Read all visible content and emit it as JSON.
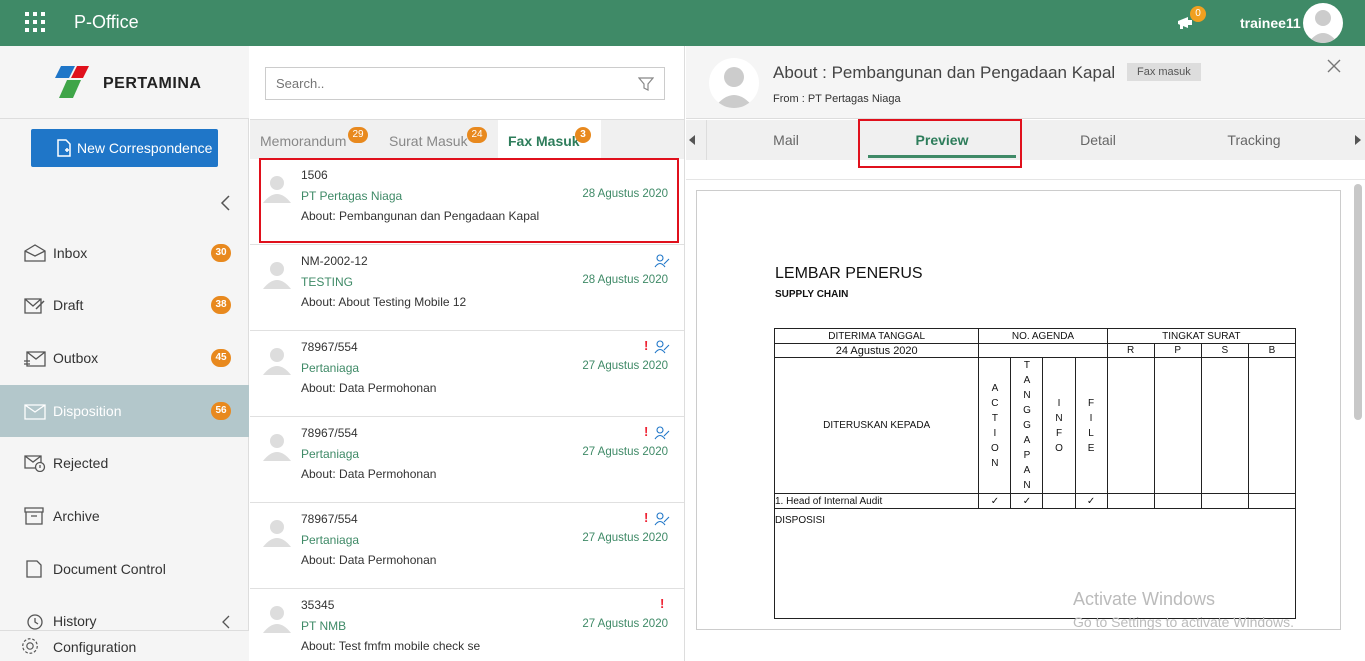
{
  "topbar": {
    "app_title": "P-Office",
    "notif_count": "0",
    "user_name": "trainee11",
    "bg_color": "#3f8a67"
  },
  "sidebar": {
    "logo_text": "PERTAMINA",
    "new_button": "New Correspondence",
    "items": [
      {
        "label": "Inbox",
        "badge": "30",
        "icon": "inbox-icon"
      },
      {
        "label": "Draft",
        "badge": "38",
        "icon": "draft-icon"
      },
      {
        "label": "Outbox",
        "badge": "45",
        "icon": "outbox-icon"
      },
      {
        "label": "Disposition",
        "badge": "56",
        "icon": "disposition-icon"
      },
      {
        "label": "Rejected",
        "badge": "",
        "icon": "rejected-icon"
      },
      {
        "label": "Archive",
        "badge": "",
        "icon": "archive-icon"
      },
      {
        "label": "Document Control",
        "badge": "",
        "icon": "document-icon"
      },
      {
        "label": "History",
        "badge": "",
        "icon": "history-icon"
      }
    ],
    "config_label": "Configuration"
  },
  "list": {
    "search_placeholder": "Search..",
    "tabs": [
      {
        "label": "Memorandum",
        "badge": "29"
      },
      {
        "label": "Surat Masuk",
        "badge": "24"
      },
      {
        "label": "Fax Masuk",
        "badge": "3"
      }
    ],
    "items": [
      {
        "code": "1506",
        "sender": "PT Pertagas Niaga",
        "date": "28 Agustus 2020",
        "about": "About: Pembangunan dan Pengadaan Kapal",
        "excl": "",
        "user": false
      },
      {
        "code": "NM-2002-12",
        "sender": "TESTING",
        "date": "28 Agustus 2020",
        "about": "About: About Testing Mobile 12",
        "excl": "",
        "user": true
      },
      {
        "code": "78967/554",
        "sender": "Pertaniaga",
        "date": "27 Agustus 2020",
        "about": "About: Data Permohonan",
        "excl": "!",
        "user": true
      },
      {
        "code": "78967/554",
        "sender": "Pertaniaga",
        "date": "27 Agustus 2020",
        "about": "About: Data Permohonan",
        "excl": "!",
        "user": true
      },
      {
        "code": "78967/554",
        "sender": "Pertaniaga",
        "date": "27 Agustus 2020",
        "about": "About: Data Permohonan",
        "excl": "!",
        "user": true
      },
      {
        "code": "35345",
        "sender": "PT NMB",
        "date": "27 Agustus 2020",
        "about": "About: Test fmfm mobile check se",
        "excl": "!",
        "user": false
      }
    ]
  },
  "detail": {
    "title": "About : Pembangunan dan Pengadaan Kapal",
    "tag": "Fax masuk",
    "from": "From : PT Pertagas Niaga",
    "tabs": [
      "Mail",
      "Preview",
      "Detail",
      "Tracking"
    ]
  },
  "doc": {
    "title": "LEMBAR PENERUS",
    "subtitle": "SUPPLY CHAIN",
    "col_diterima": "DITERIMA TANGGAL",
    "col_agenda": "NO. AGENDA",
    "col_tingkat": "TINGKAT SURAT",
    "date_value": "24 Agustus 2020",
    "levels": [
      "R",
      "P",
      "S",
      "B"
    ],
    "diteruskan": "DITERUSKAN KEPADA",
    "actions": [
      "ACTION",
      "TANGGAPAN",
      "INFO",
      "FILE"
    ],
    "row1": "1. Head of Internal Audit",
    "check": "✓",
    "disposisi": "DISPOSISI"
  },
  "watermark": {
    "line1": "Activate Windows",
    "line2": "Go to Settings to activate Windows."
  }
}
